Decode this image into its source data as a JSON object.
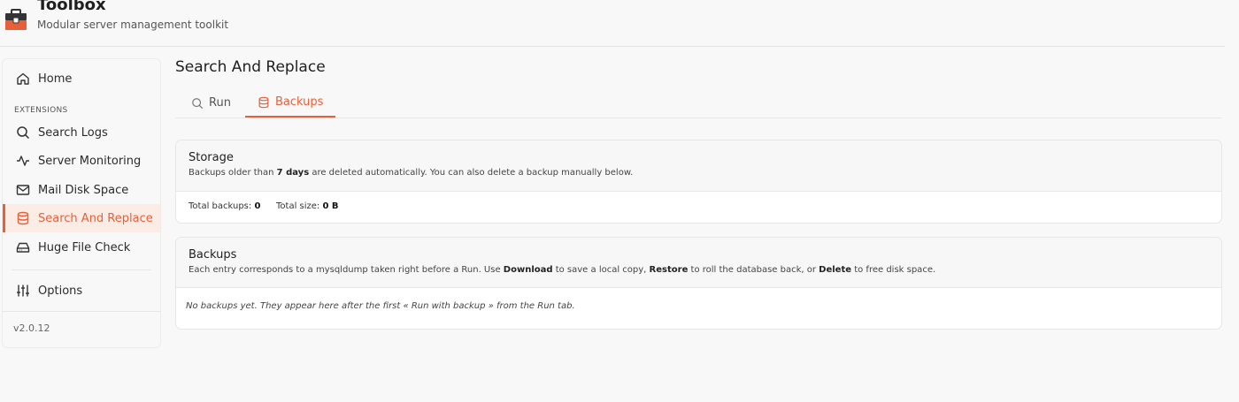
{
  "app": {
    "title": "Toolbox",
    "subtitle": "Modular server management toolkit",
    "brand_icon": "toolbox-icon",
    "accent_color": "#e8603a"
  },
  "sidebar": {
    "home": {
      "label": "Home",
      "icon": "home-icon"
    },
    "section_label": "EXTENSIONS",
    "items": [
      {
        "label": "Search Logs",
        "icon": "search-icon"
      },
      {
        "label": "Server Monitoring",
        "icon": "activity-icon"
      },
      {
        "label": "Mail Disk Space",
        "icon": "mail-icon"
      },
      {
        "label": "Search And Replace",
        "icon": "database-icon",
        "active": true
      },
      {
        "label": "Huge File Check",
        "icon": "hard-drive-icon"
      }
    ],
    "options": {
      "label": "Options",
      "icon": "sliders-icon"
    },
    "version": "v2.0.12"
  },
  "main": {
    "title": "Search And Replace",
    "tabs": [
      {
        "label": "Run",
        "icon": "search-icon"
      },
      {
        "label": "Backups",
        "icon": "database-icon",
        "active": true
      }
    ]
  },
  "storage": {
    "title": "Storage",
    "desc_before": "Backups older than ",
    "desc_days": "7 days",
    "desc_after": " are deleted automatically. You can also delete a backup manually below.",
    "total_backups_label": "Total backups:",
    "total_backups_value": "0",
    "total_size_label": "Total size:",
    "total_size_value": "0 B"
  },
  "backups": {
    "title": "Backups",
    "desc_1": "Each entry corresponds to a mysqldump taken right before a Run. Use ",
    "desc_download": "Download",
    "desc_2": " to save a local copy, ",
    "desc_restore": "Restore",
    "desc_3": " to roll the database back, or ",
    "desc_delete": "Delete",
    "desc_4": " to free disk space.",
    "empty": "No backups yet. They appear here after the first « Run with backup » from the Run tab."
  }
}
